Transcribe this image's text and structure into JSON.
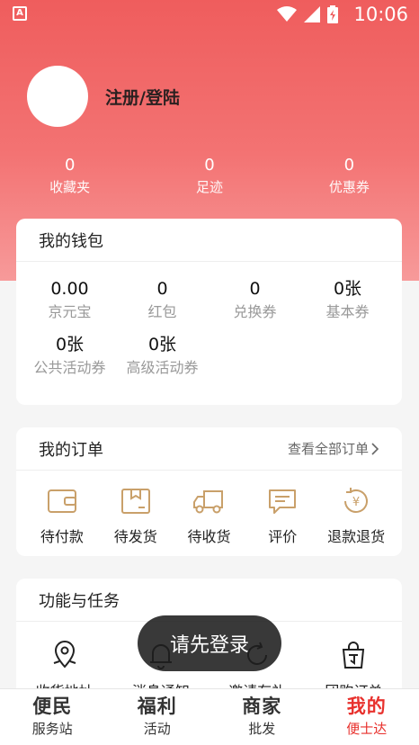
{
  "status_bar": {
    "time": "10:06",
    "app_badge": "A"
  },
  "profile": {
    "login_label": "注册/登陆"
  },
  "stats": [
    {
      "value": "0",
      "label": "收藏夹"
    },
    {
      "value": "0",
      "label": "足迹"
    },
    {
      "value": "0",
      "label": "优惠券"
    }
  ],
  "wallet": {
    "title": "我的钱包",
    "items": [
      {
        "value": "0.00",
        "label": "京元宝"
      },
      {
        "value": "0",
        "label": "红包"
      },
      {
        "value": "0",
        "label": "兑换券"
      },
      {
        "value": "0张",
        "label": "基本券"
      },
      {
        "value": "0张",
        "label": "公共活动券"
      },
      {
        "value": "0张",
        "label": "高级活动券"
      }
    ]
  },
  "orders": {
    "title": "我的订单",
    "view_all": "查看全部订单",
    "items": [
      {
        "label": "待付款",
        "icon": "wallet-icon"
      },
      {
        "label": "待发货",
        "icon": "box-icon"
      },
      {
        "label": "待收货",
        "icon": "truck-icon"
      },
      {
        "label": "评价",
        "icon": "comment-icon"
      },
      {
        "label": "退款退货",
        "icon": "refund-icon"
      }
    ]
  },
  "tasks": {
    "title": "功能与任务",
    "items": [
      {
        "label": "收货地址",
        "icon": "location-icon"
      },
      {
        "label": "消息通知",
        "icon": "bell-icon"
      },
      {
        "label": "邀请有礼",
        "icon": "refresh-icon"
      },
      {
        "label": "团购订单",
        "icon": "bag-icon"
      }
    ]
  },
  "toast": "请先登录",
  "tabbar": [
    {
      "title": "便民",
      "sub": "服务站"
    },
    {
      "title": "福利",
      "sub": "活动"
    },
    {
      "title": "商家",
      "sub": "批发"
    },
    {
      "title": "我的",
      "sub": "便士达"
    }
  ],
  "colors": {
    "accent": "#e8312d",
    "hero_top": "#ef5d5d",
    "icon_gold": "#c9a06a"
  }
}
